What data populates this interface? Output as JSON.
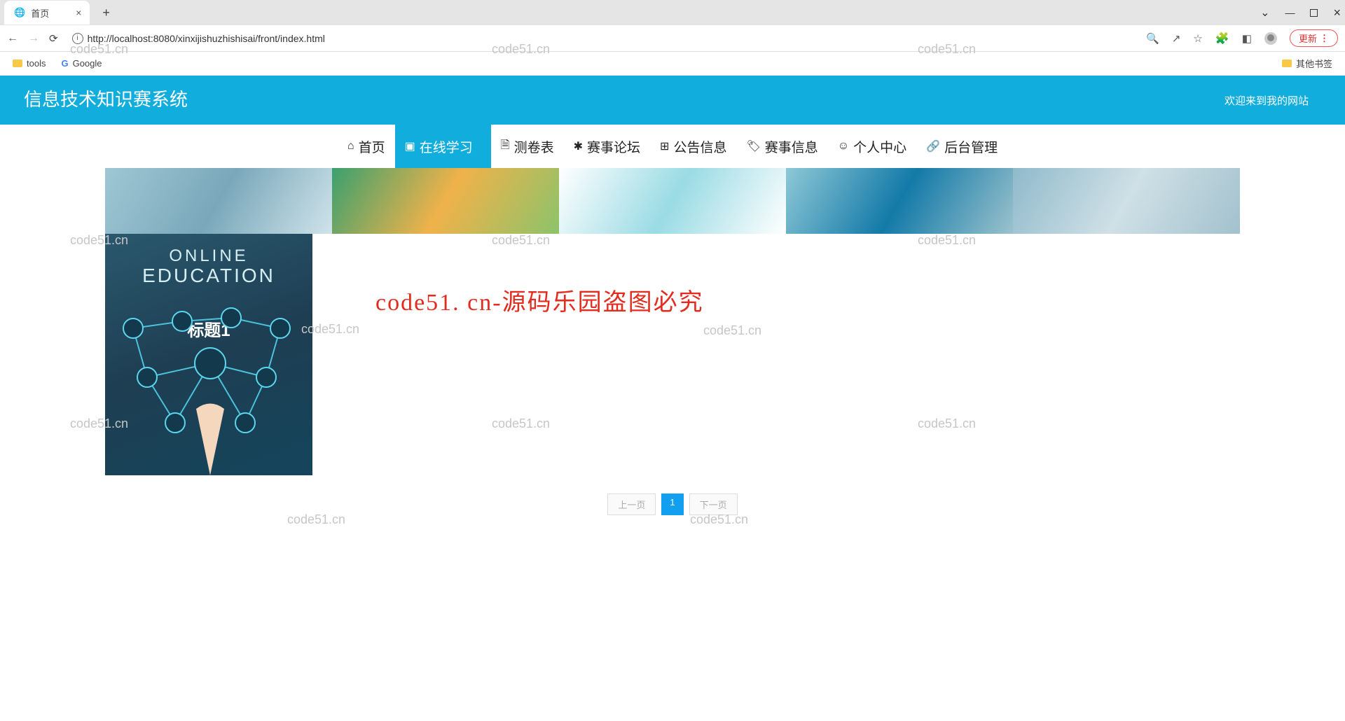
{
  "browser": {
    "tab_title": "首页",
    "url": "http://localhost:8080/xinxijishuzhishisai/front/index.html",
    "update_button": "更新",
    "bookmarks": {
      "tools": "tools",
      "google": "Google",
      "other": "其他书签"
    }
  },
  "header": {
    "site_title": "信息技术知识赛系统",
    "welcome": "欢迎来到我的网站"
  },
  "nav": {
    "items": [
      {
        "label": "首页",
        "icon": "⌂"
      },
      {
        "label": "在线学习",
        "icon": "▣",
        "active": true
      },
      {
        "label": "测卷表",
        "icon": "🗎"
      },
      {
        "label": "赛事论坛",
        "icon": "✱"
      },
      {
        "label": "公告信息",
        "icon": "⊞"
      },
      {
        "label": "赛事信息",
        "icon": "🏷"
      },
      {
        "label": "个人中心",
        "icon": "☺"
      },
      {
        "label": "后台管理",
        "icon": "🔗"
      }
    ]
  },
  "card": {
    "line1": "ONLINE",
    "line2": "EDUCATION",
    "overlay_title": "标题1"
  },
  "center_text": "code51. cn-源码乐园盗图必究",
  "pager": {
    "prev": "上一页",
    "page": "1",
    "next": "下一页"
  },
  "watermark": "code51.cn"
}
